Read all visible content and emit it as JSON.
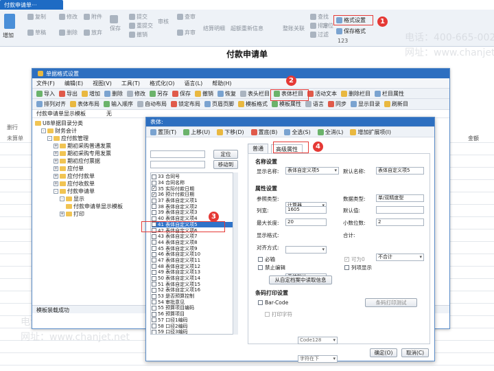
{
  "outer_tab": "付款申请单···",
  "ribbon": {
    "add": "增加",
    "copy": "复制",
    "draft": "草稿",
    "modify": "修改",
    "delete": "删除",
    "attachment": "附件",
    "abandon": "放弃",
    "save": "保存",
    "submit": "提交",
    "resubmit": "重提交",
    "revoke": "撤销",
    "audit": "审核",
    "query": "查审",
    "unaudit": "弃审",
    "close": "结算明细",
    "super_cross": "超额重新信息",
    "integrate": "整账关联",
    "find": "查找",
    "sort": "排序",
    "filter": "过滤",
    "locate": "定位",
    "format_settings": "格式设置",
    "save_format": "保存格式",
    "format_number": "123"
  },
  "page_title": "付款申请单",
  "bg_cols": {
    "c1": "删行",
    "c2": "未算单",
    "amount": "金额"
  },
  "watermarks": [
    "电话：400-665-0028",
    "网址：www.chanjet.net"
  ],
  "win1": {
    "title": "单据格式设置",
    "menu": [
      "文件(F)",
      "编辑(E)",
      "视图(V)",
      "工具(T)",
      "格式化(O)",
      "语言(L)",
      "帮助(H)"
    ],
    "toolbar1": [
      "导入",
      "导出",
      "增加",
      "删除",
      "修改",
      "另存",
      "保存",
      "撤销",
      "恢复",
      "表头栏目",
      "表体栏目",
      "活动文本",
      "删除栏目",
      "栏目属性"
    ],
    "toolbar2": [
      "排列对齐",
      "表体布局",
      "输入顺序",
      "自动布局",
      "锁定布局",
      "页眉页脚",
      "模板格式",
      "模板属性",
      "语言",
      "同步",
      "显示目录",
      "刷新目"
    ],
    "template_label": "付款申请单显示模板",
    "template_value": "无",
    "tree": [
      {
        "label": "U8单据目录分类",
        "indent": 0,
        "exp": ""
      },
      {
        "label": "财务会计",
        "indent": 1,
        "exp": "-"
      },
      {
        "label": "应付款管理",
        "indent": 2,
        "exp": "-"
      },
      {
        "label": "期初采购普通发票",
        "indent": 3,
        "exp": "+"
      },
      {
        "label": "期初采购专用发票",
        "indent": 3,
        "exp": "+"
      },
      {
        "label": "期初应付票据",
        "indent": 3,
        "exp": "+"
      },
      {
        "label": "应付单",
        "indent": 3,
        "exp": "+"
      },
      {
        "label": "应付付款单",
        "indent": 3,
        "exp": "+"
      },
      {
        "label": "应付收款单",
        "indent": 3,
        "exp": "+"
      },
      {
        "label": "付款申请单",
        "indent": 3,
        "exp": "-"
      },
      {
        "label": "显示",
        "indent": 4,
        "exp": "-"
      },
      {
        "label": "付款申请单显示模板",
        "indent": 5,
        "exp": ""
      },
      {
        "label": "打印",
        "indent": 4,
        "exp": "+"
      }
    ],
    "status": "模板装载成功"
  },
  "win2": {
    "title": "表体:",
    "toolbar": [
      "置顶(T)",
      "上移(U)",
      "下移(D)",
      "置底(B)",
      "全选(S)",
      "全消(L)",
      "增加扩展项(I)"
    ],
    "locate_btn": "定位",
    "move_to_btn": "移动到",
    "list": [
      {
        "t": "33 合同号",
        "c": false
      },
      {
        "t": "34 合同名称",
        "c": false
      },
      {
        "t": "35 实际付款日期",
        "c": true
      },
      {
        "t": "36 预计付款日期",
        "c": true
      },
      {
        "t": "37 表体自定义项1",
        "c": false
      },
      {
        "t": "38 表体自定义项2",
        "c": false
      },
      {
        "t": "39 表体自定义项3",
        "c": false
      },
      {
        "t": "40 表体自定义项4",
        "c": false
      },
      {
        "t": "41 表体自定义项5",
        "c": false,
        "sel": true
      },
      {
        "t": "42 表体自定义项6",
        "c": false
      },
      {
        "t": "43 表体自定义项7",
        "c": false
      },
      {
        "t": "44 表体自定义项8",
        "c": false
      },
      {
        "t": "45 表体自定义项9",
        "c": false
      },
      {
        "t": "46 表体自定义项10",
        "c": false
      },
      {
        "t": "47 表体自定义项11",
        "c": false
      },
      {
        "t": "48 表体自定义项12",
        "c": false
      },
      {
        "t": "49 表体自定义项13",
        "c": false
      },
      {
        "t": "50 表体自定义项14",
        "c": false
      },
      {
        "t": "51 表体自定义项15",
        "c": false
      },
      {
        "t": "52 表体自定义项16",
        "c": false
      },
      {
        "t": "53 是否预算控制",
        "c": false
      },
      {
        "t": "54 审批意见",
        "c": false
      },
      {
        "t": "55 预算项目编码",
        "c": false
      },
      {
        "t": "56 预算项目",
        "c": false
      },
      {
        "t": "57 口径1编码",
        "c": false
      },
      {
        "t": "58 口径2编码",
        "c": false
      },
      {
        "t": "59 口径3编码",
        "c": false
      }
    ],
    "tabs": [
      "普通",
      "高级属性"
    ],
    "name_section": "名称设置",
    "display_name_lbl": "显示名称:",
    "display_name": "表体自定义项5",
    "default_name_lbl": "默认名称:",
    "default_name": "表体自定义项5",
    "attr_section": "属性设置",
    "ref_type_lbl": "参照类型:",
    "ref_type": "计算器",
    "data_type_lbl": "数据类型:",
    "data_type": "单/双精度型",
    "col_width_lbl": "列宽:",
    "col_width": "1605",
    "default_value_lbl": "默认值:",
    "default_value": "",
    "max_len_lbl": "最大长度:",
    "max_len": "20",
    "decimals_lbl": "小数位数:",
    "decimals": "2",
    "display_format_lbl": "显示格式:",
    "display_format": "",
    "total_lbl": "合计:",
    "total": "不合计",
    "align_lbl": "对齐方式:",
    "align": "系统默认",
    "required": "必输",
    "editable": "可为0",
    "forbid_edit": "禁止编辑",
    "col_show": "列项显示",
    "read_archive_btn": "从自定档案中读取信息",
    "barcode_section": "条码打印设置",
    "barcode_lbl": "Bar-Code",
    "barcode_val": "Code128",
    "print_char_lbl": "打印字符",
    "print_char_val": "字符在下",
    "barcode_test_btn": "条码打印测试",
    "ok": "确定(O)",
    "cancel": "取消(C)"
  },
  "callouts": [
    "1",
    "2",
    "3",
    "4"
  ]
}
